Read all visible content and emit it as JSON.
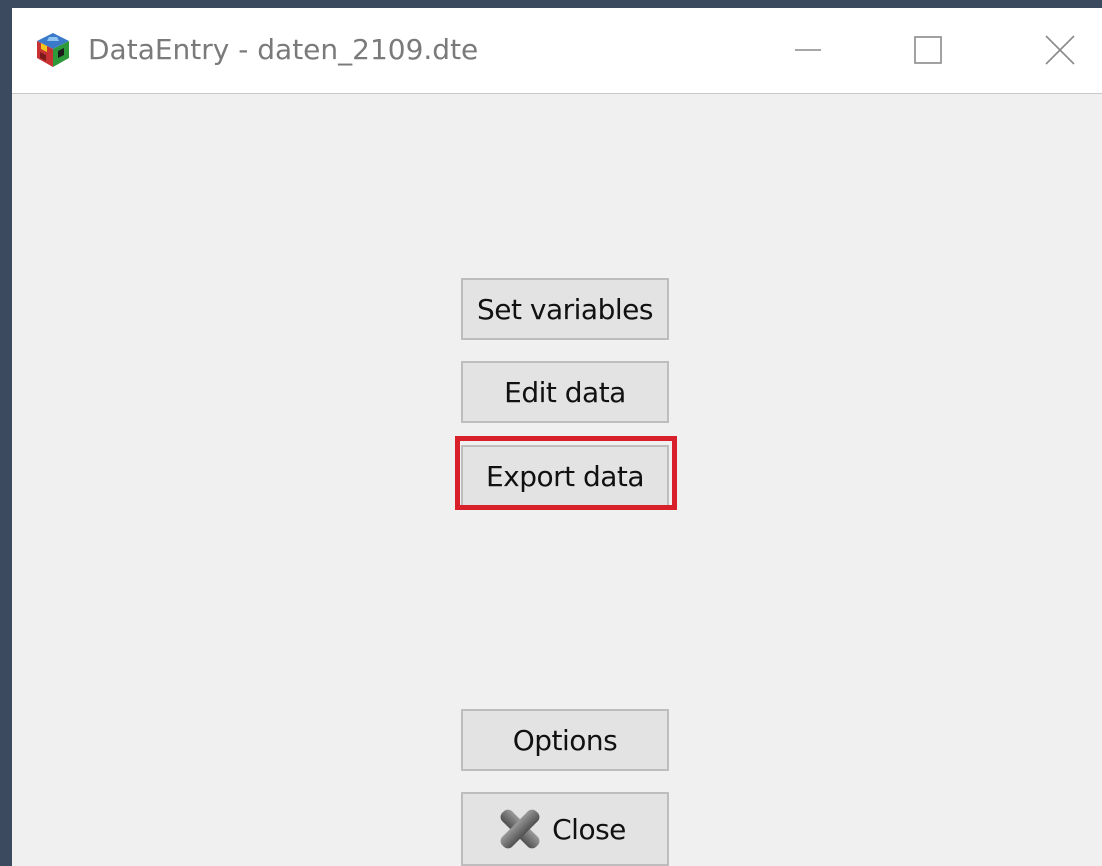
{
  "window": {
    "title": "DataEntry - daten_2109.dte",
    "app_icon": "colored-cube-icon",
    "controls": {
      "minimize_icon": "minimize-icon",
      "maximize_icon": "maximize-icon",
      "close_icon": "close-icon"
    }
  },
  "main": {
    "buttons": {
      "set_variables": "Set variables",
      "edit_data": "Edit data",
      "export_data": "Export data",
      "options": "Options",
      "close": "Close"
    },
    "close_button_icon": "gray-x-icon",
    "highlighted_button": "export_data",
    "highlight_color": "#d8202b"
  },
  "colors": {
    "desktop": "#3c4a60",
    "window_bg": "#f0f0f0",
    "titlebar_bg": "#ffffff",
    "title_text": "#7a7a7a",
    "button_bg": "#e3e3e3",
    "button_border": "#bdbdbd"
  }
}
